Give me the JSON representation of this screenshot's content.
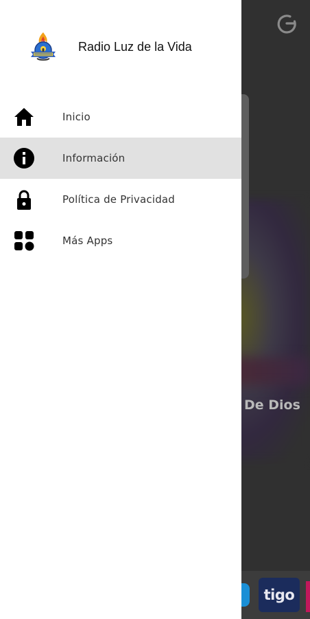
{
  "drawer": {
    "app_title": "Radio Luz de la Vida",
    "logo": "radio-station-logo",
    "items": [
      {
        "label": "Inicio",
        "icon": "home-icon",
        "active": false
      },
      {
        "label": "Información",
        "icon": "info-icon",
        "active": true
      },
      {
        "label": "Política de Privacidad",
        "icon": "lock-icon",
        "active": false
      },
      {
        "label": "Más Apps",
        "icon": "apps-grid-icon",
        "active": false
      }
    ]
  },
  "background": {
    "caption_fragment": "De Dios",
    "sponsor_logo": "tigo",
    "power_icon": "power-icon"
  },
  "colors": {
    "drawer_bg": "#ffffff",
    "active_item_bg": "#e1e1e1",
    "background_app": "#303030",
    "sponsor_badge": "#1b2c5c"
  }
}
